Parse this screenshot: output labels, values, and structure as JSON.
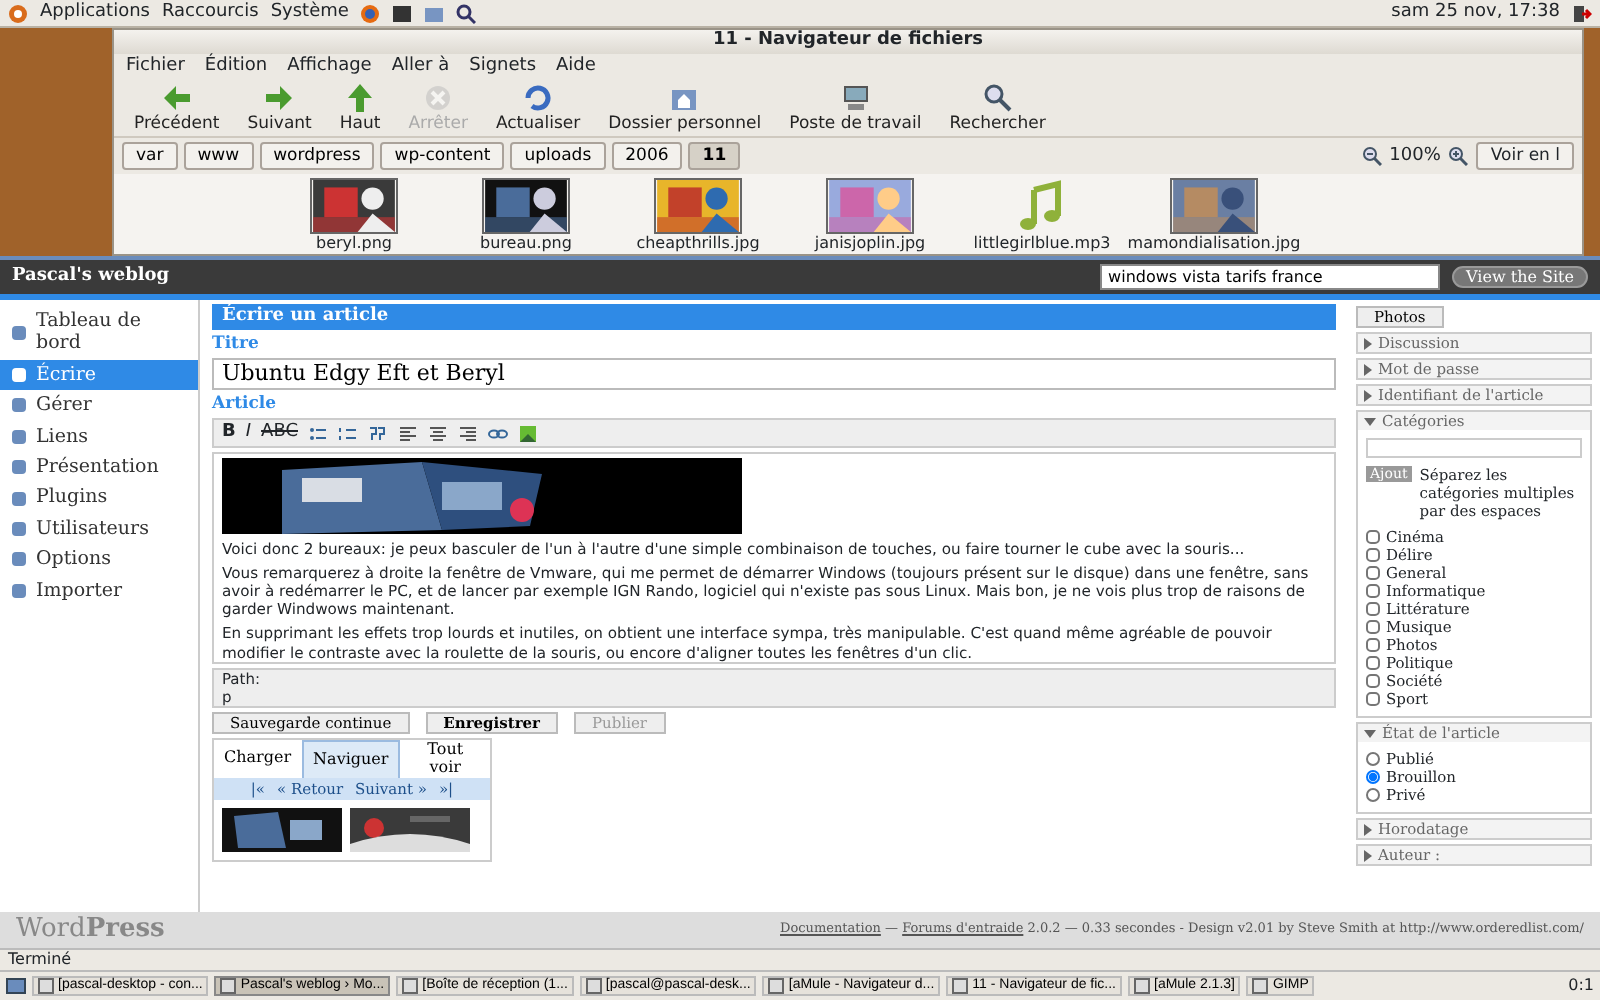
{
  "top_panel": {
    "menus": [
      "Applications",
      "Raccourcis",
      "Système"
    ],
    "clock": "sam 25 nov, 17:38"
  },
  "file_manager": {
    "title": "11 - Navigateur de fichiers",
    "menu": [
      "Fichier",
      "Édition",
      "Affichage",
      "Aller à",
      "Signets",
      "Aide"
    ],
    "toolbar": [
      {
        "label": "Précédent",
        "disabled": false
      },
      {
        "label": "Suivant",
        "disabled": false
      },
      {
        "label": "Haut",
        "disabled": false
      },
      {
        "label": "Arrêter",
        "disabled": true
      },
      {
        "label": "Actualiser",
        "disabled": false
      },
      {
        "label": "Dossier personnel",
        "disabled": false
      },
      {
        "label": "Poste de travail",
        "disabled": false
      },
      {
        "label": "Rechercher",
        "disabled": false
      }
    ],
    "path": [
      {
        "label": "var",
        "selected": false
      },
      {
        "label": "www",
        "selected": false
      },
      {
        "label": "wordpress",
        "selected": false
      },
      {
        "label": "wp-content",
        "selected": false
      },
      {
        "label": "uploads",
        "selected": false
      },
      {
        "label": "2006",
        "selected": false
      },
      {
        "label": "11",
        "selected": true
      }
    ],
    "zoom": "100%",
    "view": "Voir en l",
    "files": [
      {
        "name": "beryl.png",
        "kind": "picture"
      },
      {
        "name": "bureau.png",
        "kind": "picture"
      },
      {
        "name": "cheapthrills.jpg",
        "kind": "picture"
      },
      {
        "name": "janisjoplin.jpg",
        "kind": "picture"
      },
      {
        "name": "littlegirlblue.mp3",
        "kind": "audio"
      },
      {
        "name": "mamondialisation.jpg",
        "kind": "picture"
      }
    ]
  },
  "browser": {
    "search": "windows vista tarifs france",
    "blog_title": "Pascal's weblog",
    "view_site": "View the Site",
    "admin_menu": [
      {
        "label": "Tableau de bord",
        "selected": false
      },
      {
        "label": "Écrire",
        "selected": true
      },
      {
        "label": "Gérer",
        "selected": false
      },
      {
        "label": "Liens",
        "selected": false
      },
      {
        "label": "Présentation",
        "selected": false
      },
      {
        "label": "Plugins",
        "selected": false
      },
      {
        "label": "Utilisateurs",
        "selected": false
      },
      {
        "label": "Options",
        "selected": false
      },
      {
        "label": "Importer",
        "selected": false
      }
    ],
    "page_tab": "Écrire un article",
    "title_label": "Titre",
    "post_title": "Ubuntu Edgy Eft et Beryl",
    "article_label": "Article",
    "format_buttons": [
      "B",
      "I",
      "ABC"
    ],
    "paragraphs": [
      "Voici donc 2 bureaux: je peux basculer de l'un à l'autre d'une simple combinaison de touches, ou faire tourner le cube avec la souris...",
      "Vous remarquerez à droite la fenêtre de Vmware, qui me permet de démarrer Windows (toujours présent sur le disque) dans une fenêtre, sans avoir à redémarrer le PC, et de lancer par exemple IGN Rando, logiciel qui n'existe pas sous Linux. Mais bon, je ne vois plus trop de raisons de garder Windwows maintenant.",
      "En supprimant les effets trop lourds et inutiles, on obtient une interface sympa, très manipulable. C'est quand même agréable de pouvoir modifier le contraste avec la roulette de la souris,  ou encore d'aligner toutes les fenêtres d'un clic."
    ],
    "path_label": "Path:",
    "path_value": "p",
    "buttons": [
      "Sauvegarde continue",
      "Enregistrer",
      "Publier"
    ],
    "uploader": {
      "tabs": [
        {
          "label": "Charger",
          "selected": false
        },
        {
          "label": "Naviguer",
          "selected": true
        },
        {
          "label": "Tout voir",
          "selected": false
        }
      ],
      "nav": [
        "|«",
        "« Retour",
        "Suivant »",
        "»|"
      ]
    },
    "sidebar": {
      "photos_button": "Photos",
      "sections": [
        {
          "label": "Discussion",
          "expanded": false
        },
        {
          "label": "Mot de passe",
          "expanded": false
        },
        {
          "label": "Identifiant de l'article",
          "expanded": false
        },
        {
          "kind": "categories",
          "label": "Catégories",
          "expanded": true,
          "add_button": "Ajout",
          "hint": "Séparez les catégories multiples par des espaces",
          "items": [
            {
              "label": "Cinéma",
              "checked": false
            },
            {
              "label": "Délire",
              "checked": false
            },
            {
              "label": "General",
              "checked": false
            },
            {
              "label": "Informatique",
              "checked": false
            },
            {
              "label": "Littérature",
              "checked": false
            },
            {
              "label": "Musique",
              "checked": false
            },
            {
              "label": "Photos",
              "checked": false
            },
            {
              "label": "Politique",
              "checked": false
            },
            {
              "label": "Société",
              "checked": false
            },
            {
              "label": "Sport",
              "checked": false
            }
          ]
        },
        {
          "kind": "status",
          "label": "État de l'article",
          "expanded": true,
          "options": [
            {
              "label": "Publié",
              "selected": false
            },
            {
              "label": "Brouillon",
              "selected": true
            },
            {
              "label": "Privé",
              "selected": false
            }
          ]
        },
        {
          "label": "Horodatage",
          "expanded": false
        },
        {
          "label": "Auteur :",
          "expanded": false
        }
      ]
    },
    "footer": {
      "logo_light": "Word",
      "logo_bold": "Press",
      "credits": [
        {
          "kind": "link",
          "text": "Documentation"
        },
        {
          "kind": "text",
          "text": " — "
        },
        {
          "kind": "link",
          "text": "Forums d'entraide"
        },
        {
          "kind": "text",
          "text": " 2.0.2 — 0.33 secondes - Design v2.01 by Steve Smith at http://www.orderedlist.com/"
        }
      ]
    }
  },
  "status_bar": "Terminé",
  "taskbar": {
    "items": [
      {
        "label": "[pascal-desktop - con...",
        "selected": false
      },
      {
        "label": "Pascal's weblog › Mo...",
        "selected": true
      },
      {
        "label": "[Boîte de réception (1...",
        "selected": false
      },
      {
        "label": "[pascal@pascal-desk...",
        "selected": false
      },
      {
        "label": "[aMule - Navigateur d...",
        "selected": false
      },
      {
        "label": "11 - Navigateur de fic...",
        "selected": false
      },
      {
        "label": "[aMule 2.1.3]",
        "selected": false
      },
      {
        "label": "GIMP",
        "selected": false
      }
    ],
    "workspace": "0:1"
  }
}
